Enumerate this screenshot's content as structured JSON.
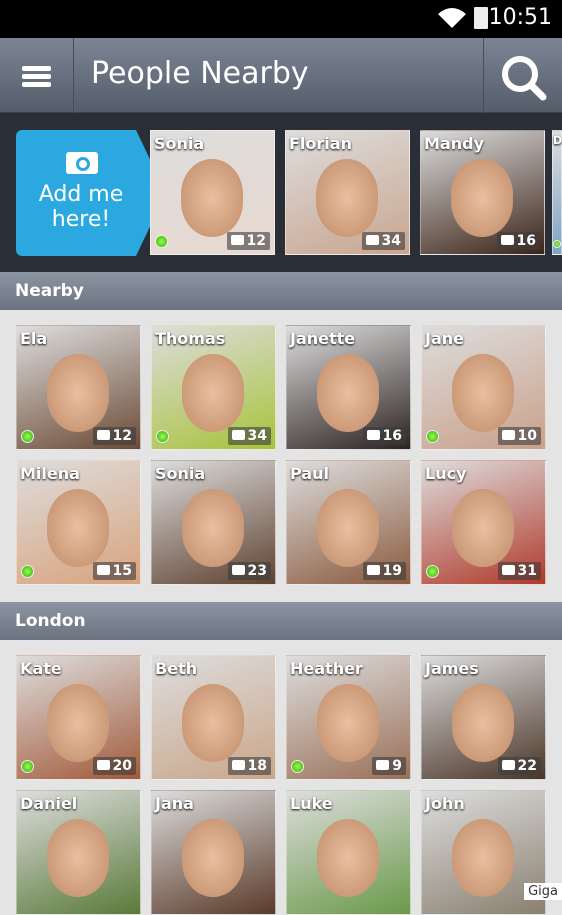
{
  "status_bar": {
    "time": "10:51",
    "icons": [
      "wifi-icon",
      "battery-icon"
    ]
  },
  "header": {
    "title": "People Nearby",
    "menu_icon": "hamburger-menu-icon",
    "search_icon": "search-icon"
  },
  "strip": {
    "add_me_label": "Add me here!",
    "add_me_icon": "camera-icon",
    "people": [
      {
        "name": "Sonia",
        "photos": "12",
        "online": true,
        "color": "#e8d8cf"
      },
      {
        "name": "Florian",
        "photos": "34",
        "online": false,
        "color": "#c9a58e"
      },
      {
        "name": "Mandy",
        "photos": "16",
        "online": false,
        "color": "#3b2418"
      },
      {
        "name": "D",
        "photos": "",
        "online": true,
        "color": "#7fa3c4"
      }
    ]
  },
  "sections": [
    {
      "title": "Nearby",
      "people": [
        {
          "name": "Ela",
          "photos": "12",
          "online": true,
          "color": "#6b4a36"
        },
        {
          "name": "Thomas",
          "photos": "34",
          "online": true,
          "color": "#a8c23a"
        },
        {
          "name": "Janette",
          "photos": "16",
          "online": false,
          "color": "#2c2322"
        },
        {
          "name": "Jane",
          "photos": "10",
          "online": true,
          "color": "#c9a08a"
        },
        {
          "name": "Milena",
          "photos": "15",
          "online": true,
          "color": "#d9a27c"
        },
        {
          "name": "Sonia",
          "photos": "23",
          "online": false,
          "color": "#5e4130"
        },
        {
          "name": "Paul",
          "photos": "19",
          "online": false,
          "color": "#8a5a3e"
        },
        {
          "name": "Lucy",
          "photos": "31",
          "online": true,
          "color": "#b03a2b"
        }
      ]
    },
    {
      "title": "London",
      "people": [
        {
          "name": "Kate",
          "photos": "20",
          "online": true,
          "color": "#a25a3a"
        },
        {
          "name": "Beth",
          "photos": "18",
          "online": false,
          "color": "#c9a68a"
        },
        {
          "name": "Heather",
          "photos": "9",
          "online": true,
          "color": "#9a7058"
        },
        {
          "name": "James",
          "photos": "22",
          "online": false,
          "color": "#4a3528"
        },
        {
          "name": "Daniel",
          "photos": "",
          "online": false,
          "color": "#5a7a3a"
        },
        {
          "name": "Jana",
          "photos": "",
          "online": false,
          "color": "#5a3a2a"
        },
        {
          "name": "Luke",
          "photos": "",
          "online": false,
          "color": "#6a9a4a"
        },
        {
          "name": "John",
          "photos": "",
          "online": false,
          "color": "#8a8070"
        }
      ]
    }
  ],
  "watermark": "Giga"
}
